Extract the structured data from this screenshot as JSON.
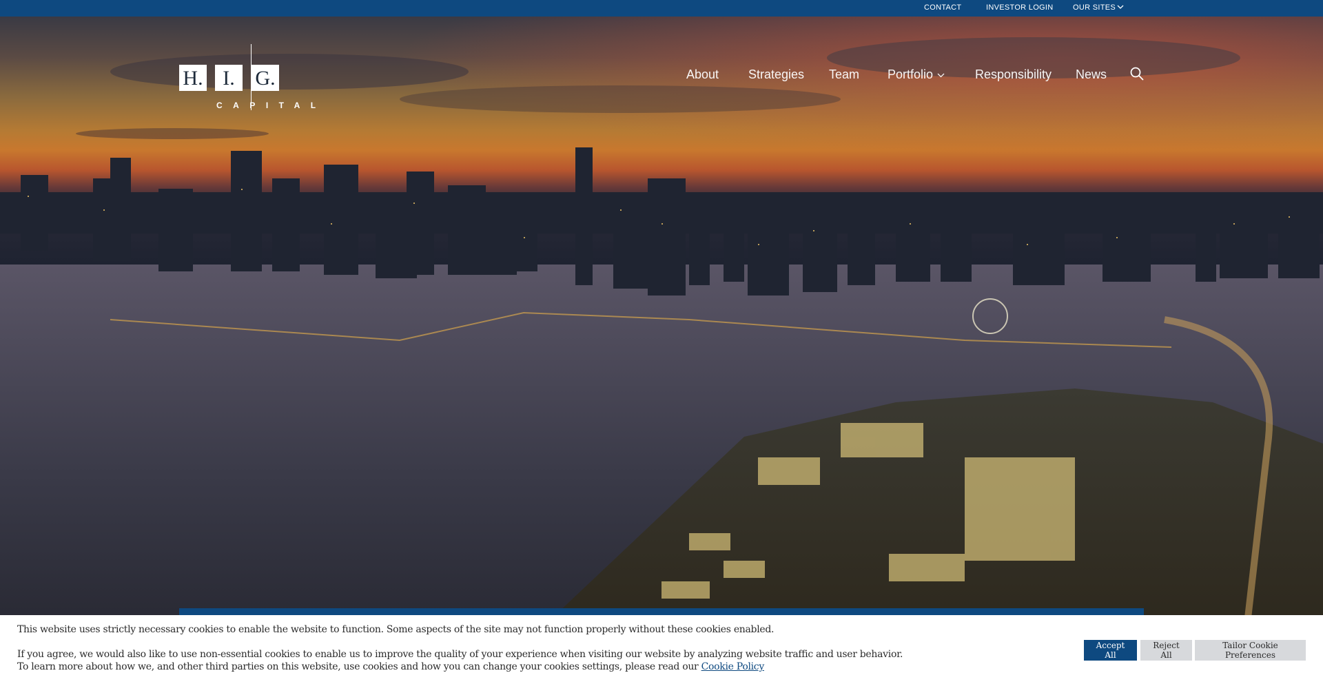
{
  "topbar": {
    "contact": "CONTACT",
    "investor_login": "INVESTOR LOGIN",
    "our_sites": "OUR SITES"
  },
  "logo": {
    "letters": [
      "H.",
      "I.",
      "G."
    ],
    "subtitle": "CAPITAL"
  },
  "nav": {
    "items": [
      "About",
      "Strategies",
      "Team",
      "Portfolio",
      "Responsibility",
      "News"
    ]
  },
  "icons": {
    "search": "search-icon",
    "dropdown": "chevron-down-icon"
  },
  "cookie": {
    "line1": "This website uses strictly necessary cookies to enable the website to function. Some aspects of the site may not function properly without these cookies enabled.",
    "line2": "If you agree, we would also like to use non-essential cookies to enable us to improve the quality of your experience when visiting our website by analyzing website traffic and user behavior. To learn more about how we, and other third parties on this website, use cookies and how you can change your cookies settings, please read our",
    "policy_link": "Cookie Policy",
    "accept": "Accept All",
    "reject": "Reject All",
    "tailor": "Tailor Cookie Preferences"
  },
  "colors": {
    "brand_blue": "#0e4980",
    "white": "#ffffff",
    "button_grey": "#d7d9dc"
  }
}
